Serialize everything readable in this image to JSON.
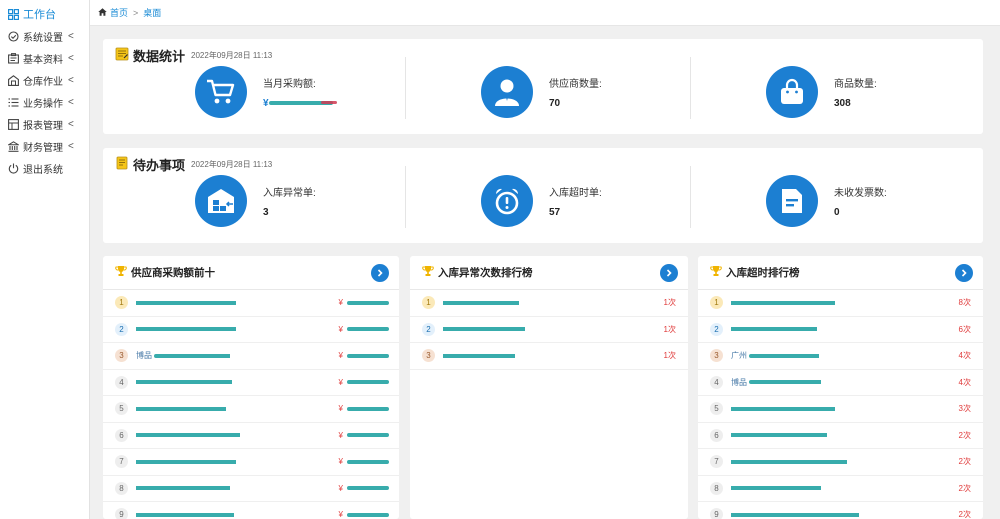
{
  "sidebar": {
    "items": [
      {
        "label": "工作台",
        "icon": "grid-icon",
        "active": true
      },
      {
        "label": "系统设置",
        "icon": "settings-icon",
        "caret": "<"
      },
      {
        "label": "基本资料",
        "icon": "id-card-icon",
        "caret": "<"
      },
      {
        "label": "仓库作业",
        "icon": "warehouse-icon",
        "caret": "<"
      },
      {
        "label": "业务操作",
        "icon": "list-icon",
        "caret": "<"
      },
      {
        "label": "报表管理",
        "icon": "report-icon",
        "caret": "<"
      },
      {
        "label": "财务管理",
        "icon": "bank-icon",
        "caret": "<"
      },
      {
        "label": "退出系统",
        "icon": "power-icon"
      }
    ]
  },
  "breadcrumb": {
    "home": "首页",
    "sep": ">",
    "current": "桌面"
  },
  "colors": {
    "accent": "#1c7fd2",
    "highlight": "#e03b3b"
  },
  "stats": {
    "title": "数据统计",
    "datetime": "2022年09月28日 11:13",
    "items": [
      {
        "label": "当月采购额:",
        "value": "¥"
      },
      {
        "label": "供应商数量:",
        "value": "70"
      },
      {
        "label": "商品数量:",
        "value": "308"
      }
    ]
  },
  "todo": {
    "title": "待办事项",
    "datetime": "2022年09月28日 11:13",
    "items": [
      {
        "label": "入库异常单:",
        "value": "3"
      },
      {
        "label": "入库超时单:",
        "value": "57"
      },
      {
        "label": "未收发票数:",
        "value": "0"
      }
    ]
  },
  "ranks": [
    {
      "title": "供应商采购额前十",
      "rows": [
        {
          "n": "1",
          "name": "",
          "val": "¥"
        },
        {
          "n": "2",
          "name": "",
          "val": "¥"
        },
        {
          "n": "3",
          "name": "博品",
          "val": "¥"
        },
        {
          "n": "4",
          "name": "",
          "val": "¥"
        },
        {
          "n": "5",
          "name": "",
          "val": "¥"
        },
        {
          "n": "6",
          "name": "",
          "val": "¥"
        },
        {
          "n": "7",
          "name": "",
          "val": "¥"
        },
        {
          "n": "8",
          "name": "",
          "val": "¥"
        },
        {
          "n": "9",
          "name": "",
          "val": "¥"
        }
      ]
    },
    {
      "title": "入库异常次数排行榜",
      "rows": [
        {
          "n": "1",
          "name": "",
          "val": "1次"
        },
        {
          "n": "2",
          "name": "",
          "val": "1次"
        },
        {
          "n": "3",
          "name": "",
          "val": "1次"
        }
      ]
    },
    {
      "title": "入库超时排行榜",
      "rows": [
        {
          "n": "1",
          "name": "",
          "val": "8次"
        },
        {
          "n": "2",
          "name": "",
          "val": "6次"
        },
        {
          "n": "3",
          "name": "广州",
          "val": "4次"
        },
        {
          "n": "4",
          "name": "博品",
          "val": "4次"
        },
        {
          "n": "5",
          "name": "",
          "val": "3次"
        },
        {
          "n": "6",
          "name": "",
          "val": "2次"
        },
        {
          "n": "7",
          "name": "",
          "val": "2次"
        },
        {
          "n": "8",
          "name": "",
          "val": "2次"
        },
        {
          "n": "9",
          "name": "",
          "val": "2次"
        }
      ]
    }
  ]
}
